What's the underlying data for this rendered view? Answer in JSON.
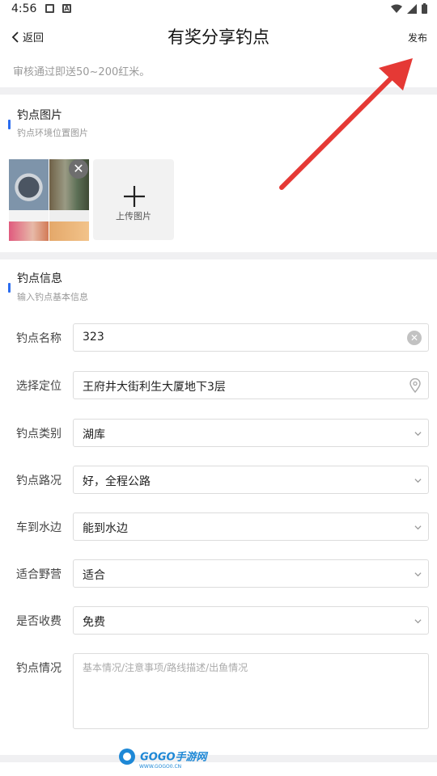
{
  "status_bar": {
    "time": "4:56"
  },
  "header": {
    "back_label": "返回",
    "title": "有奖分享钓点",
    "publish_label": "发布"
  },
  "notice": "审核通过即送50~200红米。",
  "photos_section": {
    "title": "钓点图片",
    "subtitle": "钓点环境位置图片",
    "upload_label": "上传图片"
  },
  "info_section": {
    "title": "钓点信息",
    "subtitle": "输入钓点基本信息",
    "fields": [
      {
        "label": "钓点名称",
        "value": "323"
      },
      {
        "label": "选择定位",
        "value": "王府井大街利生大厦地下3层"
      },
      {
        "label": "钓点类别",
        "value": "湖库"
      },
      {
        "label": "钓点路况",
        "value": "好，全程公路"
      },
      {
        "label": "车到水边",
        "value": "能到水边"
      },
      {
        "label": "适合野营",
        "value": "适合"
      },
      {
        "label": "是否收费",
        "value": "免费"
      }
    ],
    "description": {
      "label": "钓点情况",
      "placeholder": "基本情况/注意事项/路线描述/出鱼情况"
    }
  },
  "watermark": {
    "text": "GOGO手游网",
    "sub": "WWW.GOGO0.CN"
  },
  "colors": {
    "accent": "#2b6df0",
    "arrow": "#e53935"
  }
}
